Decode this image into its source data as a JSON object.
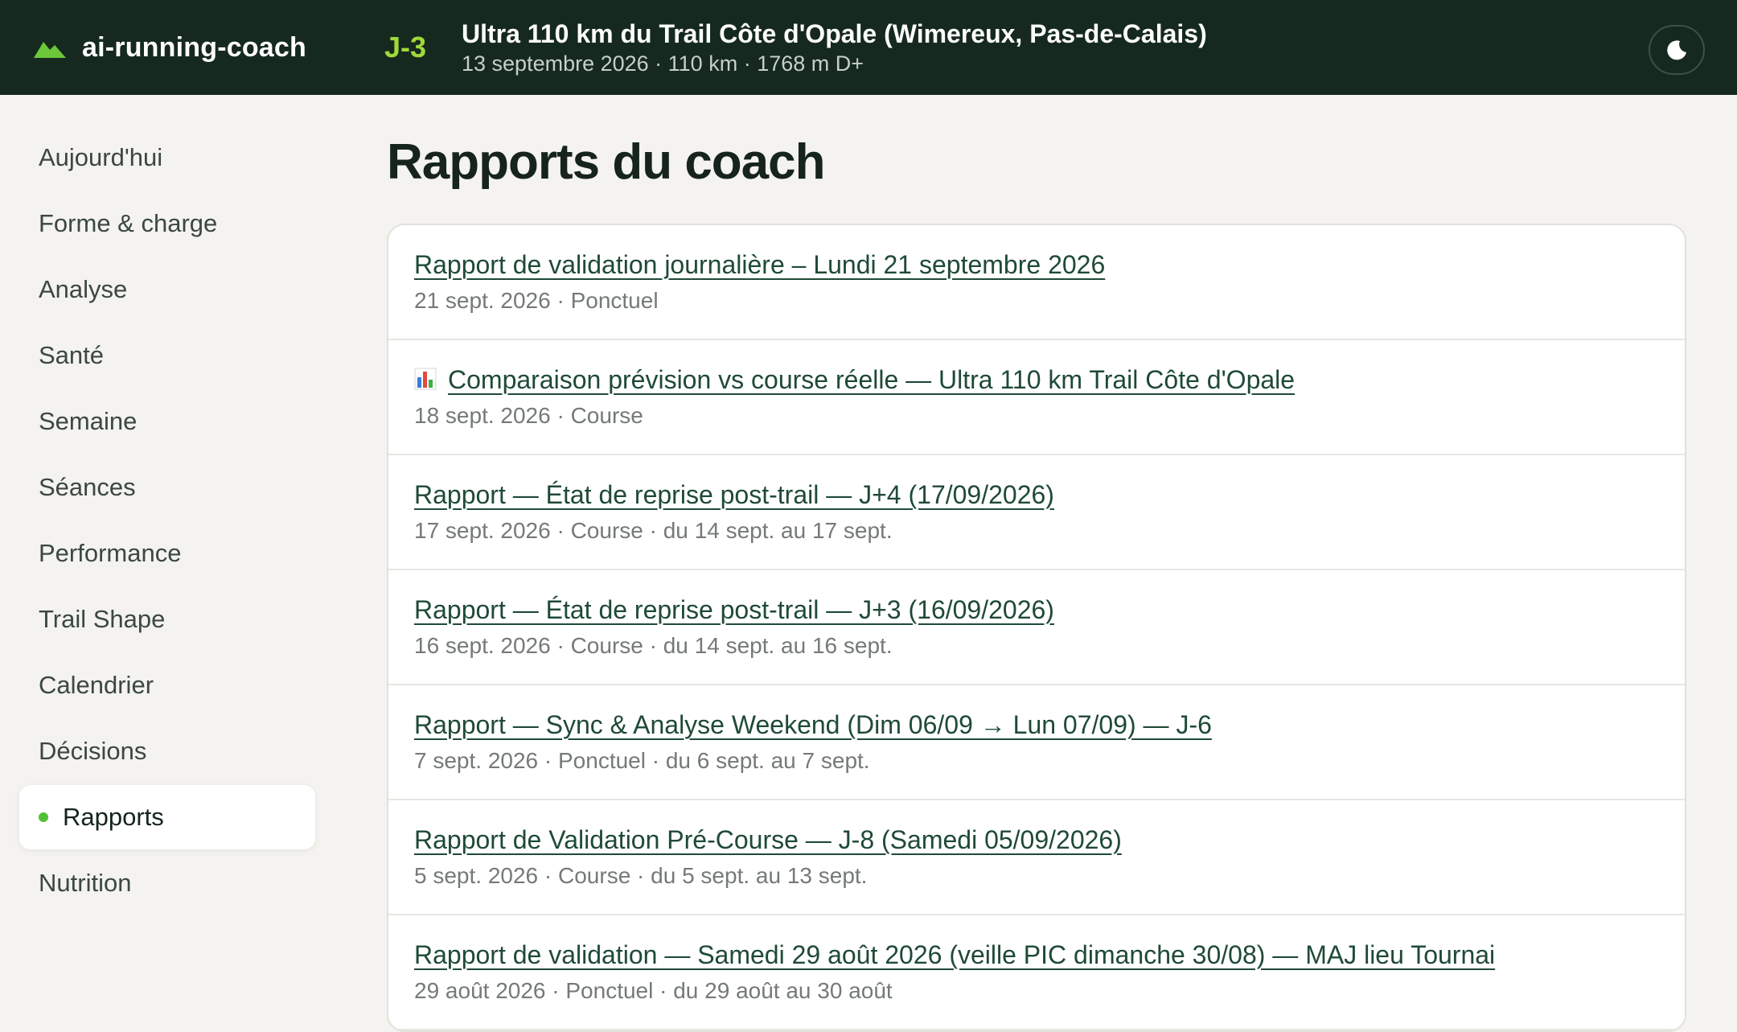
{
  "app": {
    "name": "ai-running-coach"
  },
  "race": {
    "countdown": "J-3",
    "title": "Ultra 110 km du Trail Côte d'Opale (Wimereux, Pas-de-Calais)",
    "meta": "13 septembre 2026 · 110 km · 1768 m D+"
  },
  "header": {
    "theme_toggle_icon": "moon-icon"
  },
  "sidebar": {
    "items": [
      {
        "label": "Aujourd'hui"
      },
      {
        "label": "Forme & charge"
      },
      {
        "label": "Analyse"
      },
      {
        "label": "Santé"
      },
      {
        "label": "Semaine"
      },
      {
        "label": "Séances"
      },
      {
        "label": "Performance"
      },
      {
        "label": "Trail Shape"
      },
      {
        "label": "Calendrier"
      },
      {
        "label": "Décisions"
      },
      {
        "label": "Rapports",
        "active": true
      },
      {
        "label": "Nutrition"
      }
    ]
  },
  "main": {
    "title": "Rapports du coach",
    "reports": [
      {
        "title": "Rapport de validation journalière – Lundi 21 septembre 2026",
        "meta": "21 sept. 2026 · Ponctuel"
      },
      {
        "title": "Comparaison prévision vs course réelle — Ultra 110 km Trail Côte d'Opale",
        "meta": "18 sept. 2026 · Course",
        "icon": "bar-chart-icon"
      },
      {
        "title": "Rapport — État de reprise post-trail — J+4 (17/09/2026)",
        "meta": "17 sept. 2026 · Course · du 14 sept. au 17 sept."
      },
      {
        "title": "Rapport — État de reprise post-trail — J+3 (16/09/2026)",
        "meta": "16 sept. 2026 · Course · du 14 sept. au 16 sept."
      },
      {
        "title": "Rapport — Sync & Analyse Weekend (Dim 06/09 → Lun 07/09) — J-6",
        "meta": "7 sept. 2026 · Ponctuel · du 6 sept. au 7 sept."
      },
      {
        "title": "Rapport de Validation Pré-Course — J-8 (Samedi 05/09/2026)",
        "meta": "5 sept. 2026 · Course · du 5 sept. au 13 sept."
      },
      {
        "title": "Rapport de validation — Samedi 29 août 2026 (veille PIC dimanche 30/08) — MAJ lieu Tournai",
        "meta": "29 août 2026 · Ponctuel · du 29 août au 30 août"
      }
    ]
  },
  "colors": {
    "topbar": "#16291f",
    "accent_green": "#9fd93a",
    "active_dot": "#52c034",
    "link": "#1f4a36",
    "page_bg": "#f4f3ef"
  }
}
